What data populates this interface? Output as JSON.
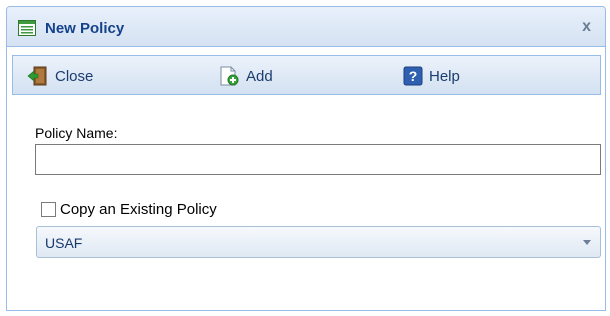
{
  "window": {
    "title": "New Policy",
    "close_glyph": "x"
  },
  "toolbar": {
    "close_label": "Close",
    "add_label": "Add",
    "help_label": "Help",
    "close_icon": "door-exit-icon",
    "add_icon": "add-document-icon",
    "help_icon": "help-icon"
  },
  "form": {
    "policy_name_label": "Policy Name:",
    "policy_name_value": "",
    "copy_existing_label": "Copy an Existing Policy",
    "copy_existing_checked": false,
    "existing_policy_selected": "USAF"
  },
  "colors": {
    "title_text": "#15428b",
    "border": "#99bbe8",
    "toolbar_text": "#1b3c6e"
  }
}
